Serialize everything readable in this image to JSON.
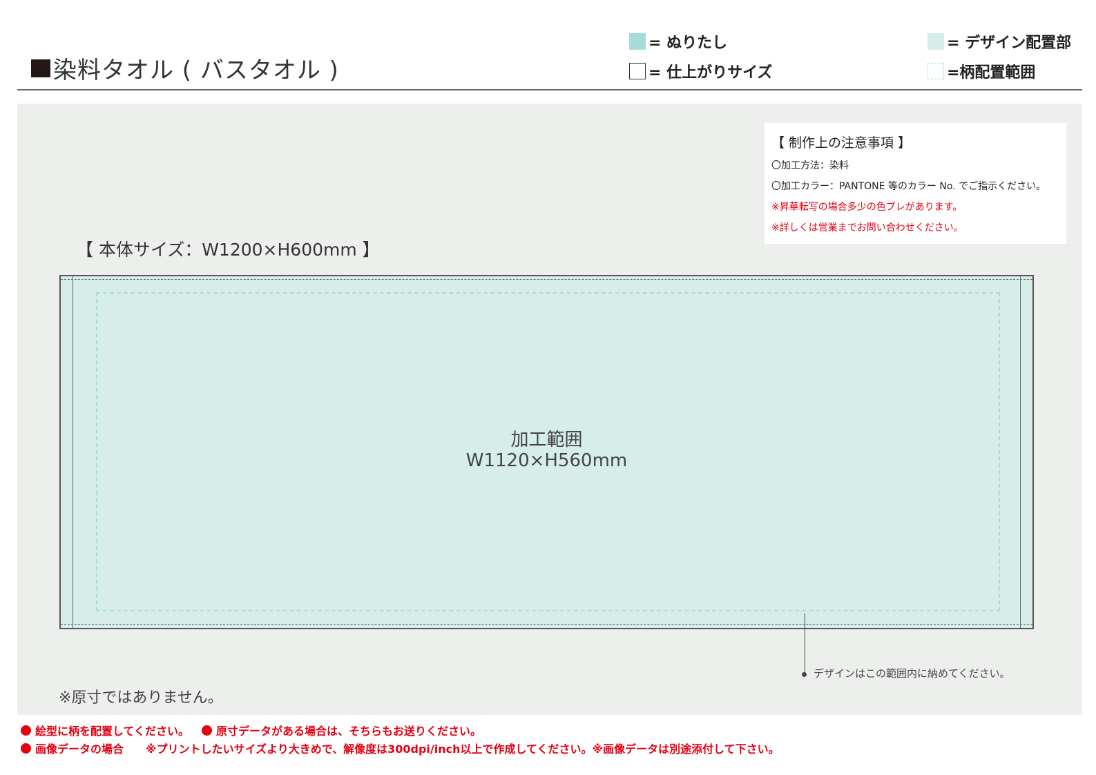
{
  "header": {
    "title": "染料タオル ( バスタオル )"
  },
  "legend": {
    "nuritashi": "= ぬりたし",
    "finish_size": "= 仕上がりサイズ",
    "design_area": "= デザイン配置部",
    "pattern_range": "=柄配置範囲",
    "colors": {
      "nuritashi": "#a6dcd9",
      "design_area": "#d6edea",
      "pattern_range": "#a6dcd9"
    }
  },
  "notes": {
    "title": "【 制作上の注意事項 】",
    "lines": [
      "〇加工方法：染料",
      "〇加工カラー：PANTONE 等のカラー No. でご指示ください。",
      "※昇華転写の場合多少の色ブレがあります。",
      "※詳しくは営業までお問い合わせください。"
    ]
  },
  "body_size": "【 本体サイズ：W1200×H600mm 】",
  "processing": {
    "label": "加工範囲",
    "size": "W1120×H560mm"
  },
  "callout": "デザインはこの範囲内に納めてください。",
  "not_actual_size": "※原寸ではありません。",
  "footer": {
    "line1_a": "絵型に柄を配置してください。",
    "line1_b": "原寸データがある場合は、そちらもお送りください。",
    "line2_a": "画像データの場合",
    "line2_b": "※プリントしたいサイズより大きめで、解像度は300dpi/inch以上で作成してください。※画像データは別途添付して下さい。"
  }
}
